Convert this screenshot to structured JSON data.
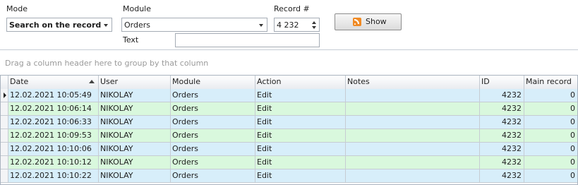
{
  "filters": {
    "mode_label": "Mode",
    "mode_value": "Search on the record",
    "module_label": "Module",
    "module_value": "Orders",
    "record_label": "Record #",
    "record_value": "4 232",
    "text_label": "Text",
    "text_value": "",
    "show_label": "Show"
  },
  "group_panel": {
    "hint": "Drag a column header here to group by that column"
  },
  "grid": {
    "columns": [
      "Date",
      "User",
      "Module",
      "Action",
      "Notes",
      "ID",
      "Main record"
    ],
    "sort_column": "Date",
    "sort_direction": "ascending",
    "rows": [
      {
        "date": "12.02.2021 10:05:49",
        "user": "NIKOLAY",
        "module": "Orders",
        "action": "Edit",
        "notes": "",
        "id": "4232",
        "main": "0"
      },
      {
        "date": "12.02.2021 10:06:14",
        "user": "NIKOLAY",
        "module": "Orders",
        "action": "Edit",
        "notes": "",
        "id": "4232",
        "main": "0"
      },
      {
        "date": "12.02.2021 10:06:33",
        "user": "NIKOLAY",
        "module": "Orders",
        "action": "Edit",
        "notes": "",
        "id": "4232",
        "main": "0"
      },
      {
        "date": "12.02.2021 10:09:53",
        "user": "NIKOLAY",
        "module": "Orders",
        "action": "Edit",
        "notes": "",
        "id": "4232",
        "main": "0"
      },
      {
        "date": "12.02.2021 10:10:06",
        "user": "NIKOLAY",
        "module": "Orders",
        "action": "Edit",
        "notes": "",
        "id": "4232",
        "main": "0"
      },
      {
        "date": "12.02.2021 10:10:12",
        "user": "NIKOLAY",
        "module": "Orders",
        "action": "Edit",
        "notes": "",
        "id": "4232",
        "main": "0"
      },
      {
        "date": "12.02.2021 10:10:22",
        "user": "NIKOLAY",
        "module": "Orders",
        "action": "Edit",
        "notes": "",
        "id": "4232",
        "main": "0"
      }
    ]
  },
  "colors": {
    "row_blue": "#d7eefa",
    "row_green": "#d9f8dd",
    "rss_orange": "#f08a24"
  }
}
